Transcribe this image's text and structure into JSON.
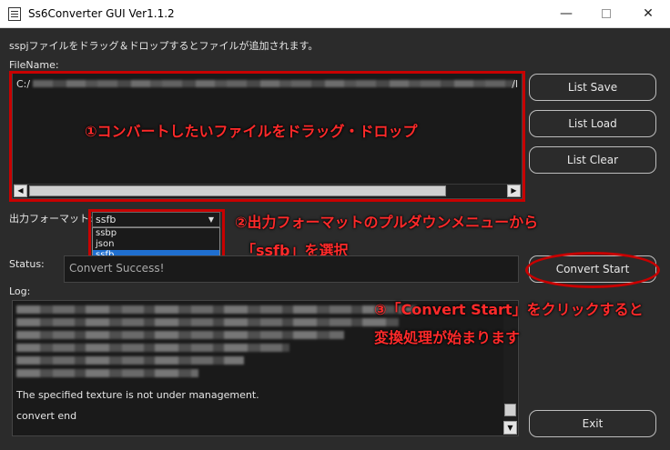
{
  "window": {
    "title": "Ss6Converter GUI Ver1.1.2",
    "minimize": "—",
    "close": "✕"
  },
  "instruction": "sspjファイルをドラッグ＆ドロップするとファイルが追加されます。",
  "filename_label": "FileName:",
  "file_list": {
    "path_prefix": "C:/",
    "path_suffix": "/l"
  },
  "buttons": {
    "list_save": "List Save",
    "list_load": "List Load",
    "list_clear": "List Clear",
    "convert_start": "Convert Start",
    "exit": "Exit"
  },
  "format": {
    "label": "出力フォーマット:",
    "selected": "ssfb",
    "options": [
      "ssbp",
      "json",
      "ssfb"
    ]
  },
  "status": {
    "label": "Status:",
    "value": "Convert Success!"
  },
  "log": {
    "label": "Log:",
    "lines": [
      "The specified texture is not under management.",
      "convert end"
    ]
  },
  "annotations": {
    "step1": "①コンバートしたいファイルをドラッグ・ドロップ",
    "step2_line1": "②出力フォーマットのプルダウンメニューから",
    "step2_line2": "「ssfb」を選択",
    "step3_line1": "③「Convert Start」をクリックすると",
    "step3_line2": "変換処理が始まります"
  },
  "colors": {
    "background": "#2b2b2b",
    "annotation": "#ff2a2a",
    "highlight_border": "#c80000",
    "selection": "#1f6fd0"
  }
}
